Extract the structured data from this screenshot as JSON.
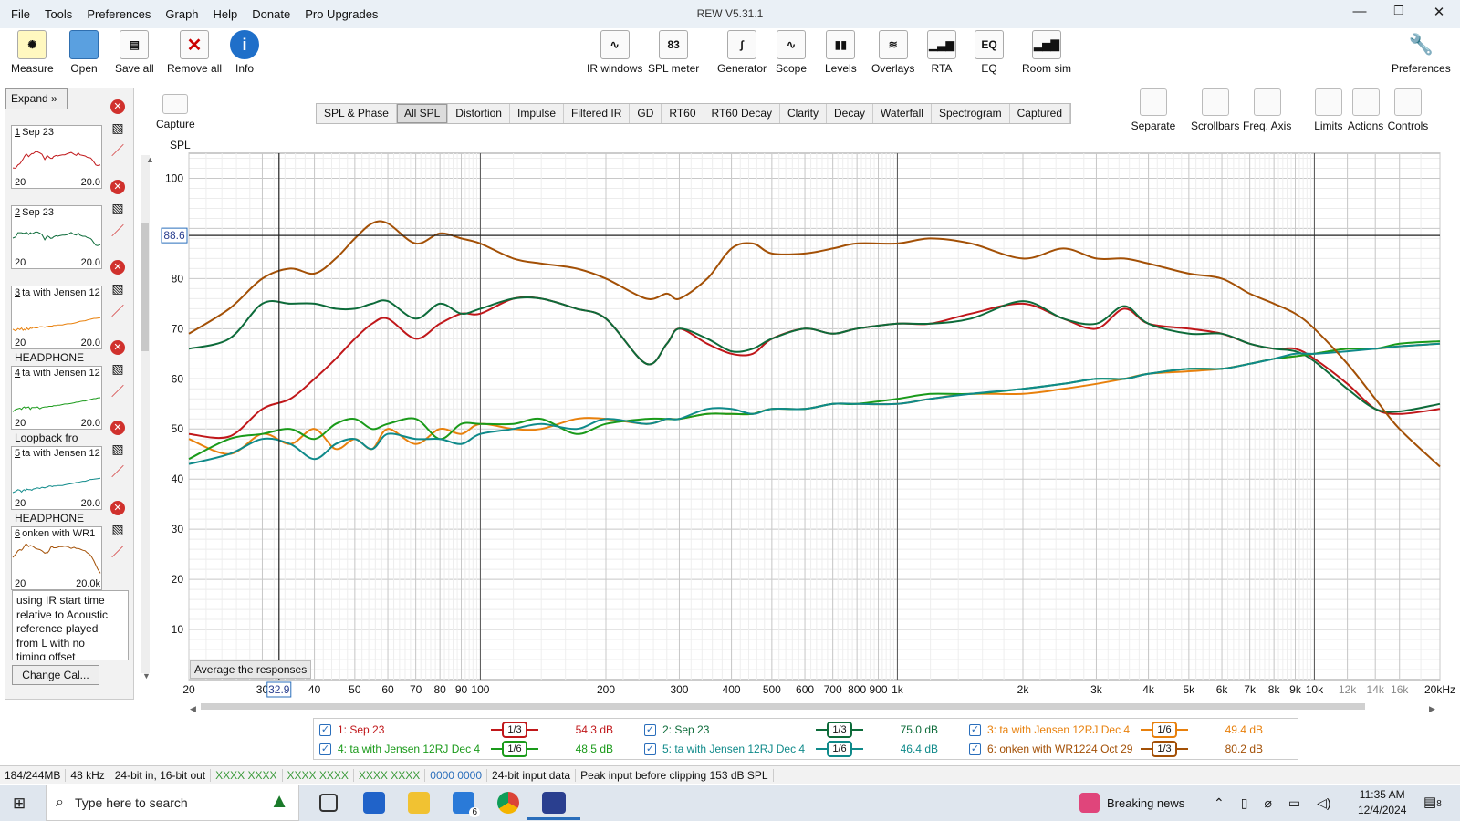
{
  "window": {
    "title": "REW V5.31.1"
  },
  "menu": [
    "File",
    "Tools",
    "Preferences",
    "Graph",
    "Help",
    "Donate",
    "Pro Upgrades"
  ],
  "toolbar_left": [
    {
      "label": "Measure",
      "icon": "mic-icon"
    },
    {
      "label": "Open",
      "icon": "folder-icon"
    },
    {
      "label": "Save all",
      "icon": "save-icon"
    },
    {
      "label": "Remove all",
      "icon": "remove-icon"
    },
    {
      "label": "Info",
      "icon": "info-icon"
    }
  ],
  "toolbar_center": [
    {
      "label": "IR windows",
      "icon": "ir-window-icon",
      "glyph": "∿"
    },
    {
      "label": "SPL meter",
      "icon": "spl-meter-icon",
      "glyph": "83"
    },
    {
      "label": "Generator",
      "icon": "generator-icon",
      "glyph": "∫"
    },
    {
      "label": "Scope",
      "icon": "scope-icon",
      "glyph": "∿"
    },
    {
      "label": "Levels",
      "icon": "levels-icon",
      "glyph": "▮▮"
    },
    {
      "label": "Overlays",
      "icon": "overlays-icon",
      "glyph": "≋"
    },
    {
      "label": "RTA",
      "icon": "rta-icon",
      "glyph": "▁▃▆"
    },
    {
      "label": "EQ",
      "icon": "eq-icon",
      "glyph": "EQ"
    },
    {
      "label": "Room sim",
      "icon": "room-sim-icon",
      "glyph": "▂▅▇"
    }
  ],
  "toolbar_right": {
    "label": "Preferences",
    "icon": "wrench-icon"
  },
  "capture": {
    "label": "Capture"
  },
  "graph_tabs": [
    "SPL & Phase",
    "All SPL",
    "Distortion",
    "Impulse",
    "Filtered IR",
    "GD",
    "RT60",
    "RT60 Decay",
    "Clarity",
    "Decay",
    "Waterfall",
    "Spectrogram",
    "Captured"
  ],
  "selected_tab": "All SPL",
  "graph_tools": [
    {
      "label": "Separate",
      "icon": "separate-icon"
    },
    {
      "label": "Scrollbars",
      "icon": "scrollbars-icon"
    },
    {
      "label": "Freq. Axis",
      "icon": "freq-axis-icon"
    },
    {
      "label": "Limits",
      "icon": "limits-icon"
    },
    {
      "label": "Actions",
      "icon": "actions-icon"
    },
    {
      "label": "Controls",
      "icon": "controls-icon"
    }
  ],
  "sidebar": {
    "expand_label": "Expand »",
    "measurements": [
      {
        "num": "1",
        "label": "Sep 23",
        "sub": "",
        "color": "#c0171a"
      },
      {
        "num": "2",
        "label": "Sep 23",
        "sub": "",
        "color": "#0d6b3a"
      },
      {
        "num": "3",
        "label": "ta with Jensen 12",
        "sub": "HEADPHONE",
        "color": "#e8800c"
      },
      {
        "num": "4",
        "label": "ta with Jensen 12",
        "sub": "Loopback fro",
        "color": "#1a9a1a"
      },
      {
        "num": "5",
        "label": "ta with Jensen 12",
        "sub": "HEADPHONE",
        "color": "#0f8a8a"
      },
      {
        "num": "6",
        "label": "onken with WR1",
        "sub": "",
        "color": "#a35006"
      }
    ],
    "mini_axis": {
      "min": "20",
      "max": "20.0",
      "max6": "20.0k"
    },
    "notes": "using IR start time relative to Acoustic reference played from  L with no timing offset",
    "change_cal": "Change Cal..."
  },
  "graph": {
    "y_title": "SPL",
    "average_button": "Average the responses",
    "cursor": {
      "y": "88.6",
      "x": "32.9"
    }
  },
  "chart_data": {
    "type": "line",
    "xlabel": "",
    "ylabel": "SPL",
    "x_scale": "log",
    "xlim": [
      20,
      20000
    ],
    "ylim": [
      0,
      105
    ],
    "x_ticks": [
      {
        "v": 20,
        "l": "20"
      },
      {
        "v": 30,
        "l": "30"
      },
      {
        "v": 40,
        "l": "40"
      },
      {
        "v": 50,
        "l": "50"
      },
      {
        "v": 60,
        "l": "60"
      },
      {
        "v": 70,
        "l": "70"
      },
      {
        "v": 80,
        "l": "80"
      },
      {
        "v": 90,
        "l": "90"
      },
      {
        "v": 100,
        "l": "100"
      },
      {
        "v": 200,
        "l": "200"
      },
      {
        "v": 300,
        "l": "300"
      },
      {
        "v": 400,
        "l": "400"
      },
      {
        "v": 500,
        "l": "500"
      },
      {
        "v": 600,
        "l": "600"
      },
      {
        "v": 700,
        "l": "700"
      },
      {
        "v": 800,
        "l": "800"
      },
      {
        "v": 900,
        "l": "900"
      },
      {
        "v": 1000,
        "l": "1k"
      },
      {
        "v": 2000,
        "l": "2k"
      },
      {
        "v": 3000,
        "l": "3k"
      },
      {
        "v": 4000,
        "l": "4k"
      },
      {
        "v": 5000,
        "l": "5k"
      },
      {
        "v": 6000,
        "l": "6k"
      },
      {
        "v": 7000,
        "l": "7k"
      },
      {
        "v": 8000,
        "l": "8k"
      },
      {
        "v": 9000,
        "l": "9k"
      },
      {
        "v": 10000,
        "l": "10k"
      },
      {
        "v": 12000,
        "l": "12k"
      },
      {
        "v": 14000,
        "l": "14k"
      },
      {
        "v": 16000,
        "l": "16k"
      },
      {
        "v": 20000,
        "l": "20kHz"
      }
    ],
    "y_ticks": [
      10,
      20,
      30,
      40,
      50,
      60,
      70,
      80,
      100
    ],
    "x": [
      20,
      25,
      30,
      35,
      40,
      45,
      50,
      55,
      60,
      70,
      80,
      90,
      100,
      120,
      140,
      170,
      200,
      250,
      280,
      300,
      350,
      400,
      450,
      500,
      600,
      700,
      800,
      1000,
      1200,
      1500,
      2000,
      2500,
      3000,
      3500,
      4000,
      5000,
      6000,
      7000,
      8000,
      9000,
      10000,
      12000,
      14000,
      16000,
      20000
    ],
    "series": [
      {
        "name": "1: Sep 23",
        "color": "#c0171a",
        "values": [
          49,
          48.5,
          54,
          56,
          60,
          64,
          68,
          71,
          72,
          68,
          71,
          73,
          73,
          76,
          76,
          74,
          72,
          63,
          67,
          70,
          67,
          65,
          65,
          68,
          70,
          69,
          70,
          71,
          71,
          73,
          75,
          72,
          70,
          74,
          71,
          70,
          69,
          67,
          66,
          66,
          64,
          59,
          54,
          53,
          54
        ]
      },
      {
        "name": "2: Sep 23",
        "color": "#0d6b3a",
        "values": [
          66,
          68,
          75,
          75,
          75,
          74,
          74,
          75,
          75.5,
          72,
          75,
          73,
          74,
          76,
          76,
          74,
          72,
          63,
          67,
          70,
          68,
          65.5,
          66,
          68,
          70,
          69,
          70,
          71,
          71,
          72,
          75.5,
          72,
          71,
          74.5,
          71,
          69,
          69,
          67,
          66,
          65.5,
          63.5,
          58,
          54,
          53.5,
          55
        ]
      },
      {
        "name": "3: ta with Jensen 12RJ Dec 4",
        "color": "#e8800c",
        "values": [
          48,
          45,
          49,
          47,
          50,
          46,
          48,
          46,
          50,
          47,
          50,
          49,
          51,
          50,
          50,
          52,
          52,
          51,
          52,
          52,
          53,
          53,
          53,
          54,
          54,
          55,
          55,
          55,
          56,
          57,
          57,
          58,
          59,
          60,
          61,
          61.5,
          62,
          63,
          64,
          64.5,
          65,
          66,
          66,
          66.5,
          67
        ]
      },
      {
        "name": "4: ta with Jensen 12RJ Dec 4",
        "color": "#1a9a1a",
        "values": [
          44,
          48,
          49,
          50,
          48,
          51,
          52,
          50,
          51,
          52,
          48,
          51,
          51,
          51,
          52,
          49,
          51,
          52,
          52,
          52,
          53,
          53,
          53,
          54,
          54,
          55,
          55,
          56,
          57,
          57,
          58,
          59,
          60,
          60,
          61,
          62,
          62,
          63,
          64,
          64.5,
          65,
          66,
          66,
          67,
          67.5
        ]
      },
      {
        "name": "5: ta with Jensen 12RJ Dec 4",
        "color": "#0f8a8a",
        "values": [
          43,
          45,
          48,
          47,
          44,
          47,
          48,
          46,
          49,
          48,
          48,
          47,
          49,
          50,
          51,
          50,
          52,
          51,
          52,
          52,
          54,
          54,
          53,
          54,
          54,
          55,
          55,
          55,
          56,
          57,
          58,
          59,
          60,
          60,
          61,
          62,
          62,
          63,
          64,
          65,
          65,
          65.5,
          66,
          66.5,
          67
        ]
      },
      {
        "name": "6: onken with WR1224 Oct 29",
        "color": "#a35006",
        "values": [
          69,
          74,
          80,
          82,
          81,
          84,
          88,
          91,
          91,
          87,
          89,
          88,
          87,
          84,
          83,
          82,
          80,
          76,
          77,
          76,
          80,
          86,
          87,
          85,
          85,
          86,
          87,
          87,
          88,
          87,
          84,
          86,
          84,
          84,
          83,
          81,
          80,
          77,
          75,
          73,
          70,
          63,
          56,
          50,
          42.5
        ]
      }
    ]
  },
  "legend": [
    {
      "label": "1: Sep 23",
      "smooth": "1/3",
      "value": "54.3 dB",
      "color": "#c0171a"
    },
    {
      "label": "2: Sep 23",
      "smooth": "1/3",
      "value": "75.0 dB",
      "color": "#0d6b3a"
    },
    {
      "label": "3: ta with Jensen 12RJ Dec 4",
      "smooth": "1/6",
      "value": "49.4 dB",
      "color": "#e8800c"
    },
    {
      "label": "4: ta with Jensen 12RJ Dec 4",
      "smooth": "1/6",
      "value": "48.5 dB",
      "color": "#1a9a1a"
    },
    {
      "label": "5: ta with Jensen 12RJ Dec 4",
      "smooth": "1/6",
      "value": "46.4 dB",
      "color": "#0f8a8a"
    },
    {
      "label": "6: onken with WR1224 Oct 29",
      "smooth": "1/3",
      "value": "80.2 dB",
      "color": "#a35006"
    }
  ],
  "status": [
    "184/244MB",
    "48 kHz",
    "24-bit in, 16-bit out",
    "XXXX XXXX",
    "XXXX XXXX",
    "XXXX XXXX",
    "0000 0000",
    "24-bit input data",
    "Peak input before clipping 153 dB SPL"
  ],
  "taskbar": {
    "search_placeholder": "Type here to search",
    "news": "Breaking news",
    "time": "11:35 AM",
    "date": "12/4/2024",
    "mail_badge": "6",
    "notif_badge": "8"
  }
}
